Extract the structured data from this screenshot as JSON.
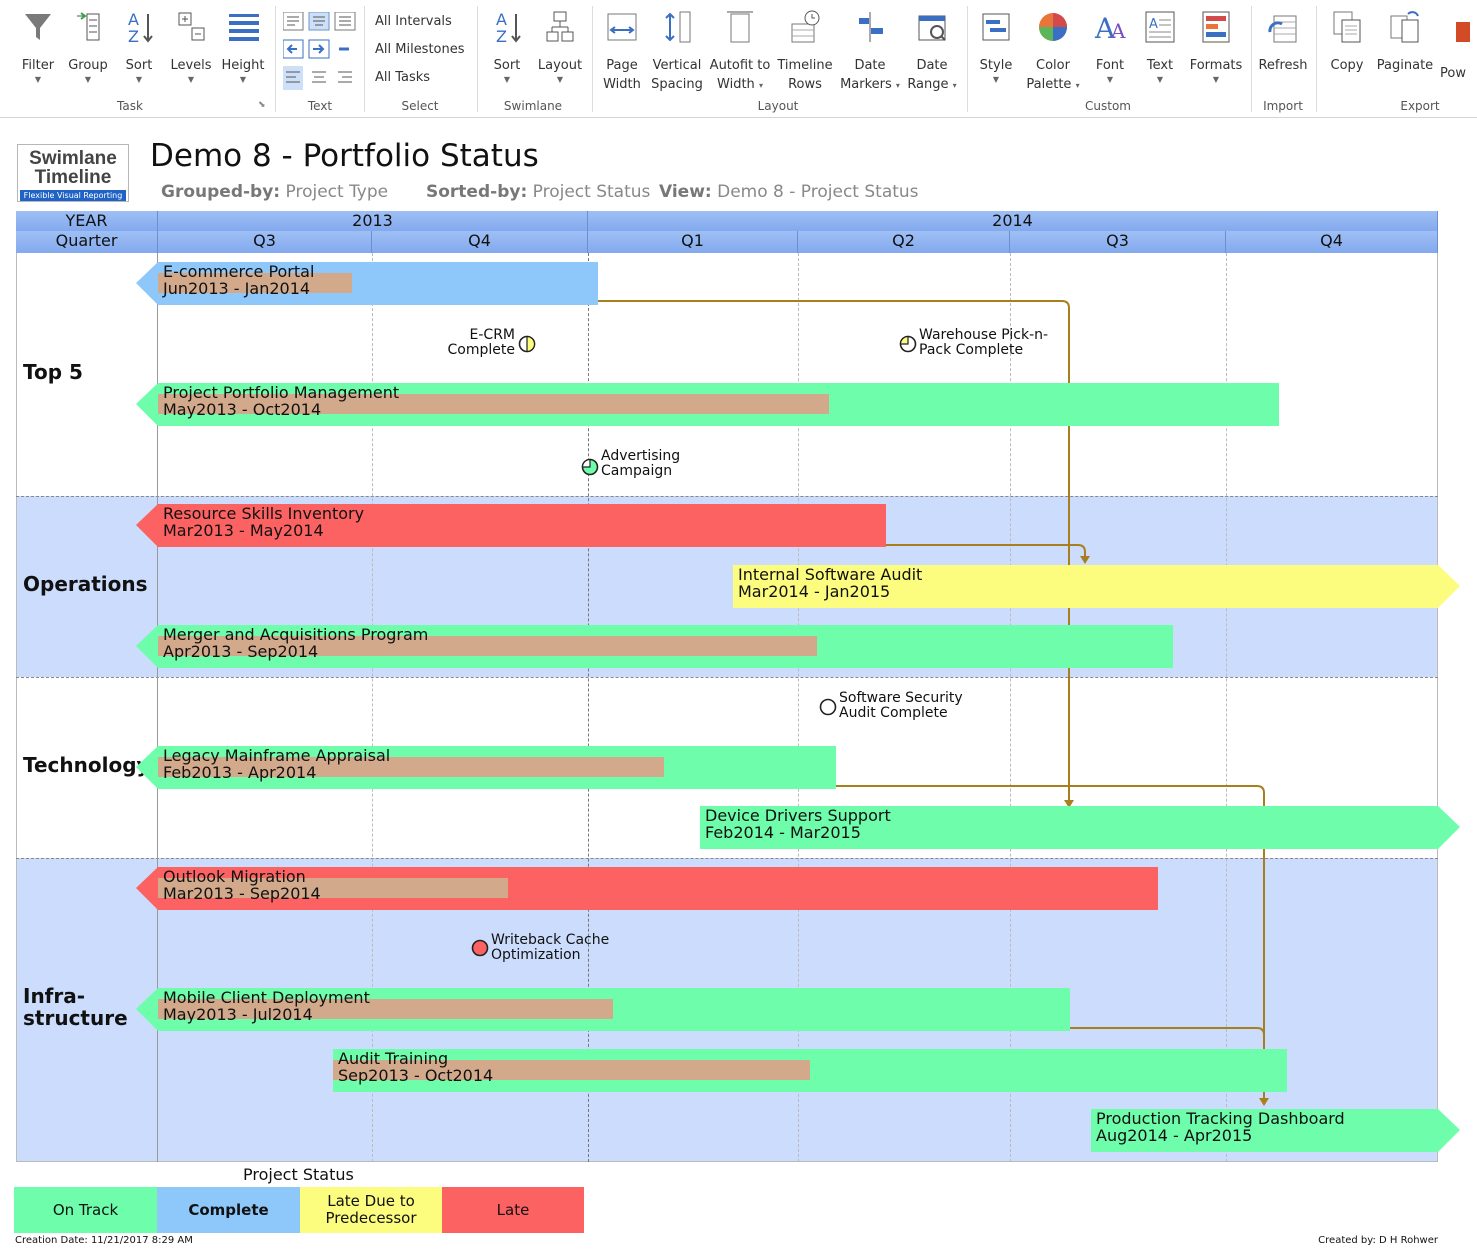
{
  "ribbon": {
    "task": {
      "filter": "Filter",
      "group": "Group",
      "sort": "Sort",
      "levels": "Levels",
      "height": "Height",
      "label": "Task"
    },
    "text": {
      "label": "Text"
    },
    "select": {
      "all_intervals": "All Intervals",
      "all_milestones": "All Milestones",
      "all_tasks": "All Tasks",
      "label": "Select"
    },
    "swimlane": {
      "sort": "Sort",
      "layout": "Layout",
      "label": "Swimlane"
    },
    "layout": {
      "page_width_1": "Page",
      "page_width_2": "Width",
      "vspacing_1": "Vertical",
      "vspacing_2": "Spacing",
      "autofit_1": "Autofit to",
      "autofit_2": "Width",
      "timeline_rows_1": "Timeline",
      "timeline_rows_2": "Rows",
      "date_markers_1": "Date",
      "date_markers_2": "Markers",
      "date_range_1": "Date",
      "date_range_2": "Range",
      "label": "Layout"
    },
    "custom": {
      "style": "Style",
      "color_palette_1": "Color",
      "color_palette_2": "Palette",
      "font": "Font",
      "text": "Text",
      "formats": "Formats",
      "label": "Custom"
    },
    "import": {
      "refresh": "Refresh",
      "label": "Import"
    },
    "export": {
      "copy": "Copy",
      "paginate": "Paginate",
      "pow": "Pow",
      "label": "Export"
    }
  },
  "logo": {
    "line1": "Swimlane",
    "line2": "Timeline",
    "tagline": "Flexible Visual Reporting"
  },
  "header": {
    "title": "Demo 8 - Portfolio Status",
    "grouped_key": "Grouped-by:",
    "grouped_val": "Project Type",
    "sorted_key": "Sorted-by:",
    "sorted_val": "Project Status",
    "view_key": "View:",
    "view_val": "Demo 8 - Project Status"
  },
  "timescale": {
    "year_label": "YEAR",
    "quarter_label": "Quarter",
    "years": [
      "2013",
      "2014"
    ],
    "quarters": [
      "Q3",
      "Q4",
      "Q1",
      "Q2",
      "Q3",
      "Q4"
    ]
  },
  "lanes": [
    {
      "name": "Top 5"
    },
    {
      "name": "Operations"
    },
    {
      "name": "Technology"
    },
    {
      "name": "Infra-",
      "name2": "structure"
    }
  ],
  "tasks": [
    {
      "name": "E-commerce Portal",
      "dates": "Jun2013 - Jan2014",
      "status": "complete",
      "progress": 0.44
    },
    {
      "name": "Project Portfolio Management",
      "dates": "May2013 - Oct2014",
      "status": "on_track",
      "progress": 0.6
    },
    {
      "name": "Resource Skills Inventory",
      "dates": "Mar2013 - May2014",
      "status": "late",
      "progress": 0
    },
    {
      "name": "Internal Software Audit",
      "dates": "Mar2014 - Jan2015",
      "status": "late_predecessor",
      "progress": 0
    },
    {
      "name": "Merger and Acquisitions Program",
      "dates": "Apr2013 - Sep2014",
      "status": "on_track",
      "progress": 0.65
    },
    {
      "name": "Legacy Mainframe Appraisal",
      "dates": "Feb2013 - Apr2014",
      "status": "on_track",
      "progress": 0.75
    },
    {
      "name": "Device Drivers Support",
      "dates": "Feb2014 - Mar2015",
      "status": "on_track",
      "progress": 0
    },
    {
      "name": "Outlook Migration",
      "dates": "Mar2013 - Sep2014",
      "status": "late",
      "progress": 0.35
    },
    {
      "name": "Mobile Client Deployment",
      "dates": "May2013 - Jul2014",
      "status": "on_track",
      "progress": 0.5
    },
    {
      "name": "Audit Training",
      "dates": "Sep2013 - Oct2014",
      "status": "on_track",
      "progress": 0.5
    },
    {
      "name": "Production Tracking Dashboard",
      "dates": "Aug2014 - Apr2015",
      "status": "on_track",
      "progress": 0
    }
  ],
  "milestones": [
    {
      "line1": "E-CRM",
      "line2": "Complete",
      "status": "late_predecessor"
    },
    {
      "line1": "Warehouse Pick-n-",
      "line2": "Pack Complete",
      "status": "late_predecessor"
    },
    {
      "line1": "Advertising",
      "line2": "Campaign",
      "status": "on_track"
    },
    {
      "line1": "Software Security",
      "line2": "Audit Complete",
      "status": "none"
    },
    {
      "line1": "Writeback Cache",
      "line2": "Optimization",
      "status": "late"
    }
  ],
  "legend": {
    "title": "Project Status",
    "on_track": "On Track",
    "complete": "Complete",
    "late_pred_1": "Late Due to",
    "late_pred_2": "Predecessor",
    "late": "Late"
  },
  "colors": {
    "on_track": "#6dfdab",
    "complete": "#8ec8fb",
    "late_predecessor": "#fcfc7e",
    "late": "#fc6262",
    "lane_alt": "#cbdcfd",
    "connector": "#a87f1e"
  },
  "footer": {
    "created": "Creation Date: 11/21/2017 8:29 AM",
    "author": "Created by: D H Rohwer"
  }
}
